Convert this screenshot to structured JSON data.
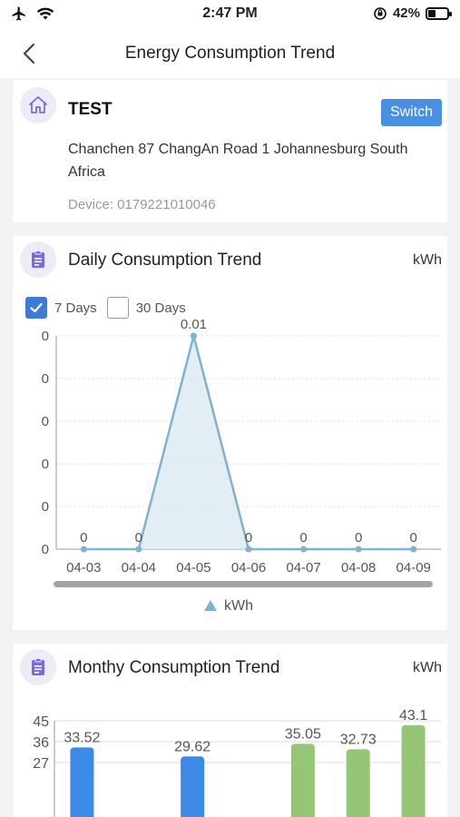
{
  "status_bar": {
    "time": "2:47 PM",
    "battery_percent": "42%",
    "battery_level": 0.42,
    "icons": [
      "airplane-icon",
      "wifi-icon",
      "orientation-lock-icon",
      "battery-icon"
    ]
  },
  "nav": {
    "title": "Energy Consumption Trend",
    "back_icon": "chevron-left-icon"
  },
  "site": {
    "icon": "home-icon",
    "name": "TEST",
    "switch_label": "Switch",
    "address": "Chanchen 87 ChangAn Road 1 Johannesburg South Africa",
    "device": "Device: 0179221010046"
  },
  "daily": {
    "icon": "clipboard-icon",
    "title": "Daily Consumption Trend",
    "unit": "kWh",
    "options": [
      {
        "label": "7 Days",
        "checked": true
      },
      {
        "label": "30 Days",
        "checked": false
      }
    ],
    "legend_label": "kWh"
  },
  "monthly": {
    "icon": "clipboard-icon",
    "title": "Monthy Consumption Trend",
    "unit": "kWh"
  },
  "colors": {
    "accent": "#4a90e2",
    "line": "#7fb2cf",
    "area": "#dce8f1",
    "bar_blue": "#3d8ae6",
    "bar_green": "#94c675"
  },
  "chart_data": [
    {
      "type": "area",
      "categories": [
        "04-03",
        "04-04",
        "04-05",
        "04-06",
        "04-07",
        "04-08",
        "04-09"
      ],
      "series": [
        {
          "name": "kWh",
          "values": [
            0,
            0,
            0.01,
            0,
            0,
            0,
            0
          ]
        }
      ],
      "data_labels": [
        "0",
        "0",
        "0.01",
        "0",
        "0",
        "0",
        "0"
      ],
      "y_tick_labels": [
        "0",
        "0",
        "0",
        "0",
        "0",
        "0"
      ],
      "ylim": [
        0,
        0.01
      ],
      "grid": true,
      "legend": "bottom-center"
    },
    {
      "type": "bar",
      "values": [
        33.52,
        null,
        29.62,
        null,
        35.05,
        32.73,
        43.1
      ],
      "data_labels": [
        "33.52",
        "",
        "29.62",
        "",
        "35.05",
        "32.73",
        "43.1"
      ],
      "bar_colors": [
        "blue",
        "",
        "blue",
        "",
        "green",
        "green",
        "green"
      ],
      "y_tick_labels": [
        "45",
        "36",
        "27"
      ],
      "ylim": [
        0,
        45
      ],
      "grid": true
    }
  ]
}
